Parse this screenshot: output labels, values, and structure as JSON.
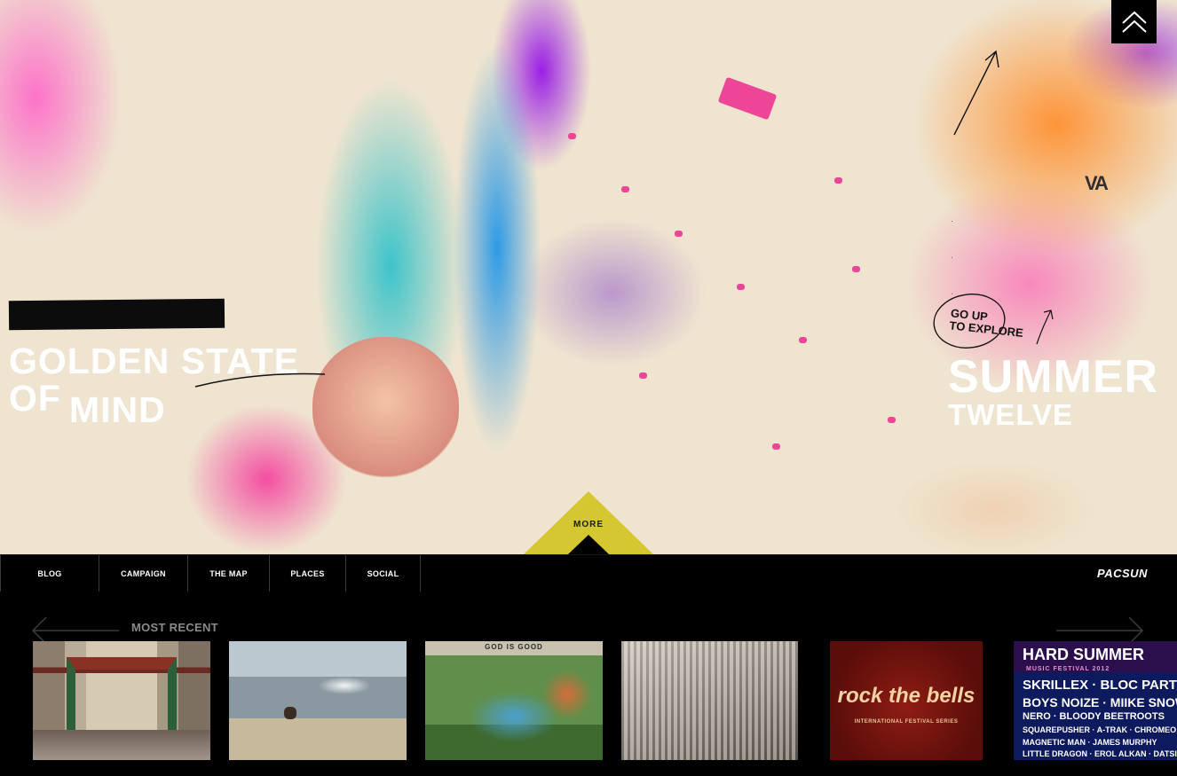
{
  "hero": {
    "logo": {
      "line1": "GOLDEN STATE",
      "line2a": "OF",
      "line2b": "MIND"
    },
    "explore": {
      "line1": "GO UP",
      "line2": "TO EXPLORE"
    },
    "campaign": {
      "title": "SUMMER",
      "subtitle": "TWELVE"
    },
    "more_label": "MORE",
    "shirt_mark": "VA"
  },
  "nav": {
    "items": [
      {
        "label": "BLOG"
      },
      {
        "label": "CAMPAIGN"
      },
      {
        "label": "THE MAP"
      },
      {
        "label": "PLACES"
      },
      {
        "label": "SOCIAL"
      }
    ],
    "brand": "PACSUN"
  },
  "recent": {
    "label": "MOST RECENT",
    "thumbs": {
      "t3_caption": "GOD IS GOOD",
      "t5_title": "rock the bells",
      "t5_sub": "INTERNATIONAL FESTIVAL SERIES",
      "t6_title": "HARD SUMMER",
      "t6_sub": "MUSIC FESTIVAL 2012",
      "t6_lineup": [
        "SKRILLEX · BLOC PARTY",
        "BOYS NOIZE · MIIKE SNOW",
        "NERO · BLOODY BEETROOTS",
        "SQUAREPUSHER · A-TRAK · CHROMEO",
        "MAGNETIC MAN · JAMES MURPHY",
        "LITTLE DRAGON · EROL ALKAN · DATSIK"
      ]
    }
  },
  "colors": {
    "accent_yellow": "#d4c72f",
    "nav_bg": "#000000",
    "label_gray": "#8a8a8a"
  },
  "icons": {
    "up": "double-chevron-up-icon",
    "prev": "arrow-left-icon",
    "next": "arrow-right-icon"
  }
}
